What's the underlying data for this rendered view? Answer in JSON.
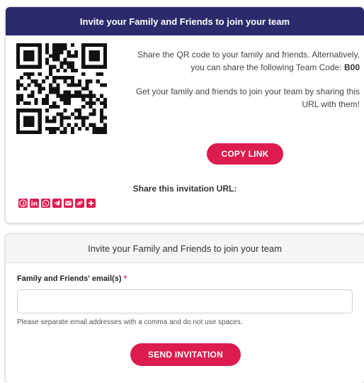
{
  "invite_card": {
    "title": "Invite your Family and Friends to join your team",
    "share_qr_text": "Share the QR code to your family and friends. Alternatively, you can share the following Team Code:",
    "team_code": "B00",
    "share_url_text": "Get your family and friends to join your team by sharing this URL with them!",
    "copy_link_label": "COPY LINK",
    "share_url_title": "Share this invitation URL:",
    "share_icons": [
      "facebook-icon",
      "linkedin-icon",
      "whatsapp-icon",
      "telegram-icon",
      "email-icon",
      "copy-link-icon",
      "more-icon"
    ]
  },
  "email_card": {
    "title": "Invite your Family and Friends to join your team",
    "field_label": "Family and Friends' email(s)",
    "required_mark": "*",
    "email_value": "",
    "email_placeholder": "",
    "help_text": "Please separate email addresses with a comma and do not use spaces.",
    "send_label": "SEND INVITATION"
  },
  "colors": {
    "header": "#2b2a6b",
    "accent": "#dc1c4e"
  }
}
